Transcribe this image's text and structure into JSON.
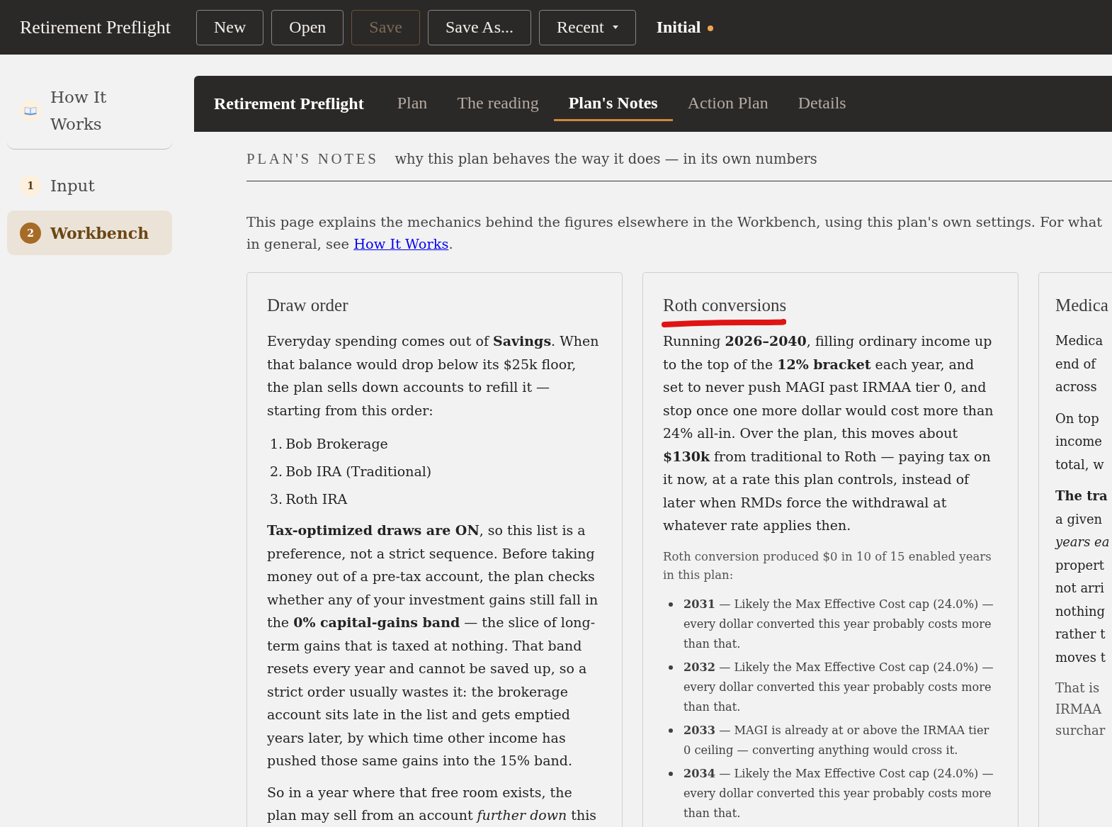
{
  "top_bar": {
    "title": "Retirement Preflight",
    "buttons": [
      {
        "label": "New",
        "kind": "button",
        "disabled": false
      },
      {
        "label": "Open",
        "kind": "button",
        "disabled": false
      },
      {
        "label": "Save",
        "kind": "button",
        "disabled": true
      },
      {
        "label": "Save As...",
        "kind": "button",
        "disabled": false
      },
      {
        "label": "Recent",
        "kind": "dropdown",
        "disabled": false
      }
    ],
    "plan": {
      "name": "Initial",
      "unsaved": true
    }
  },
  "sidebar": {
    "items": [
      {
        "label": "How It Works",
        "kind": "guide",
        "selected": false
      },
      {
        "label": "Input",
        "kind": "step",
        "badge": "1",
        "selected": false
      },
      {
        "label": "Workbench",
        "kind": "step",
        "badge": "2",
        "selected": true
      }
    ]
  },
  "nav": {
    "brand": "Retirement Preflight",
    "tabs": [
      {
        "label": "Plan",
        "selected": false
      },
      {
        "label": "The reading",
        "selected": false
      },
      {
        "label": "Plan's Notes",
        "selected": true
      },
      {
        "label": "Action Plan",
        "selected": false
      },
      {
        "label": "Details",
        "selected": false
      }
    ]
  },
  "page_header": {
    "title": "PLAN'S NOTES",
    "subtitle": "why this plan behaves the way it does — in its own numbers"
  },
  "intro": {
    "lines": [
      "This page explains the mechanics behind the figures elsewhere in the Workbench, using this plan's own settings. For what",
      "in general, see"
    ],
    "link": "How It Works",
    "after": "."
  },
  "cards": [
    {
      "title": "Draw order",
      "underlined": false,
      "blocks": [
        {
          "kind": "paragraph",
          "text": "Everyday spending comes out of **Savings**. When that balance would drop below its $25k floor, the plan sells down accounts to refill it — starting from this order:"
        },
        {
          "kind": "numbered_list",
          "items": [
            {
              "number": "1.",
              "text": "Bob Brokerage"
            },
            {
              "number": "2.",
              "text": "Bob IRA (Traditional)"
            },
            {
              "number": "3.",
              "text": "Roth IRA"
            }
          ]
        },
        {
          "kind": "paragraph",
          "text": "**Tax-optimized draws are ON**, so this list is a preference, not a strict sequence. Before taking money out of a pre-tax account, the plan checks whether any of your investment gains still fall in the **0% capital-gains band** — the slice of long-term gains that is taxed at nothing. That band resets every year and cannot be saved up, so a strict order usually wastes it: the brokerage account sits late in the list and gets emptied years later, by which time other income has pushed those same gains into the 15% band."
        },
        {
          "kind": "paragraph",
          "text": "So in a year where that free room exists, the plan may sell from an account *further down* this"
        }
      ]
    },
    {
      "title": "Roth conversions",
      "underlined": true,
      "blocks": [
        {
          "kind": "paragraph",
          "text": "Running **2026–2040**, filling ordinary income up to the top of the **12% bracket** each year, and set to never push MAGI past IRMAA tier 0, and stop once one more dollar would cost more than 24% all-in. Over the plan, this moves about **$130k** from traditional to Roth — paying tax on it now, at a rate this plan controls, instead of later when RMDs force the withdrawal at whatever rate applies then."
        },
        {
          "kind": "note",
          "text": "Roth conversion produced $0 in 10 of 15 enabled years in this plan:"
        },
        {
          "kind": "bullet_list",
          "items": [
            {
              "text": "**2031** — Likely the Max Effective Cost cap (24.0%) — every dollar converted this year probably costs more than that."
            },
            {
              "text": "**2032** — Likely the Max Effective Cost cap (24.0%) — every dollar converted this year probably costs more than that."
            },
            {
              "text": "**2033** — MAGI is already at or above the IRMAA tier 0 ceiling — converting anything would cross it."
            },
            {
              "text": "**2034** — Likely the Max Effective Cost cap (24.0%) — every dollar converted this year probably costs more than that."
            }
          ]
        }
      ]
    },
    {
      "title": "Medica",
      "underlined": false,
      "blocks": [
        {
          "kind": "paragraph",
          "lines": [
            "Medica",
            "end of",
            "across"
          ]
        },
        {
          "kind": "paragraph",
          "lines": [
            "On top",
            "income",
            "total, w"
          ]
        },
        {
          "kind": "paragraph",
          "lines": [
            "**The tra**",
            "a given",
            "*years ea*",
            "propert",
            "not arri",
            "nothing",
            "rather t",
            "moves t"
          ]
        },
        {
          "kind": "aside",
          "lines": [
            "That is",
            "IRMAA",
            "surchar"
          ]
        }
      ]
    }
  ]
}
